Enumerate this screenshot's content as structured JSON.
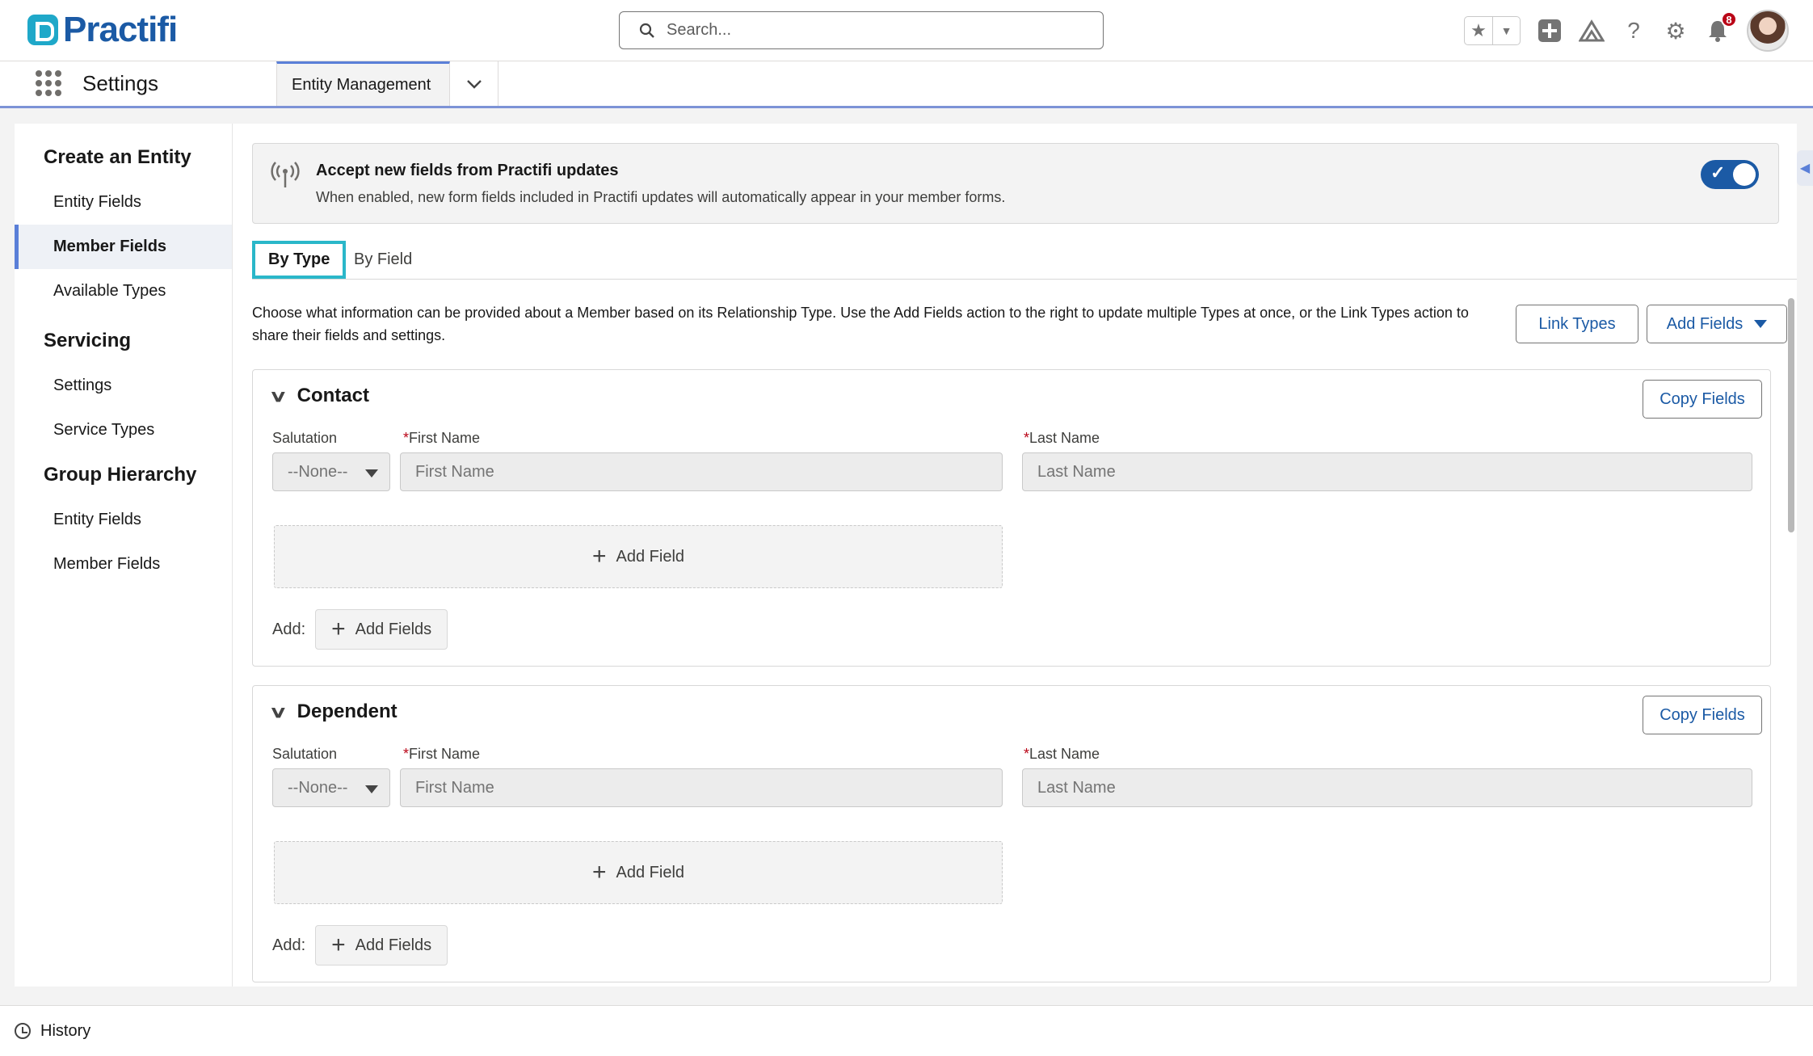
{
  "header": {
    "logo_text": "Practifi",
    "search_placeholder": "Search...",
    "notification_count": "8"
  },
  "nav": {
    "app_name": "Settings",
    "tab_label": "Entity Management"
  },
  "sidebar": {
    "groups": [
      {
        "title": "Create an Entity",
        "items": [
          "Entity Fields",
          "Member Fields",
          "Available Types"
        ]
      },
      {
        "title": "Servicing",
        "items": [
          "Settings",
          "Service Types"
        ]
      },
      {
        "title": "Group Hierarchy",
        "items": [
          "Entity Fields",
          "Member Fields"
        ]
      }
    ],
    "active_item": "Member Fields"
  },
  "banner": {
    "title": "Accept new fields from Practifi updates",
    "description": "When enabled, new form fields included in Practifi updates will automatically appear in your member forms.",
    "toggle_on": true
  },
  "tabs": [
    "By Type",
    "By Field"
  ],
  "intro": "Choose what information can be provided about a Member based on its Relationship Type. Use the Add Fields action to the right to update multiple Types at once, or the Link Types action to share their fields and settings.",
  "actions": {
    "link_types": "Link Types",
    "add_fields": "Add Fields"
  },
  "cards": [
    {
      "title": "Contact",
      "copy_label": "Copy Fields",
      "salutation_label": "Salutation",
      "salutation_value": "--None--",
      "first_label": "First Name",
      "first_placeholder": "First Name",
      "last_label": "Last Name",
      "last_placeholder": "Last Name",
      "add_field_label": "Add Field",
      "add_prefix": "Add:",
      "add_fields_label": "Add Fields"
    },
    {
      "title": "Dependent",
      "copy_label": "Copy Fields",
      "salutation_label": "Salutation",
      "salutation_value": "--None--",
      "first_label": "First Name",
      "first_placeholder": "First Name",
      "last_label": "Last Name",
      "last_placeholder": "Last Name",
      "add_field_label": "Add Field",
      "add_prefix": "Add:",
      "add_fields_label": "Add Fields"
    }
  ],
  "required_mark": "*",
  "footer": {
    "history_label": "History"
  },
  "colors": {
    "brand": "#1b5aa5",
    "accent": "#2ab7c9",
    "nav_underline": "#7d93d6",
    "required": "#ba0517"
  }
}
